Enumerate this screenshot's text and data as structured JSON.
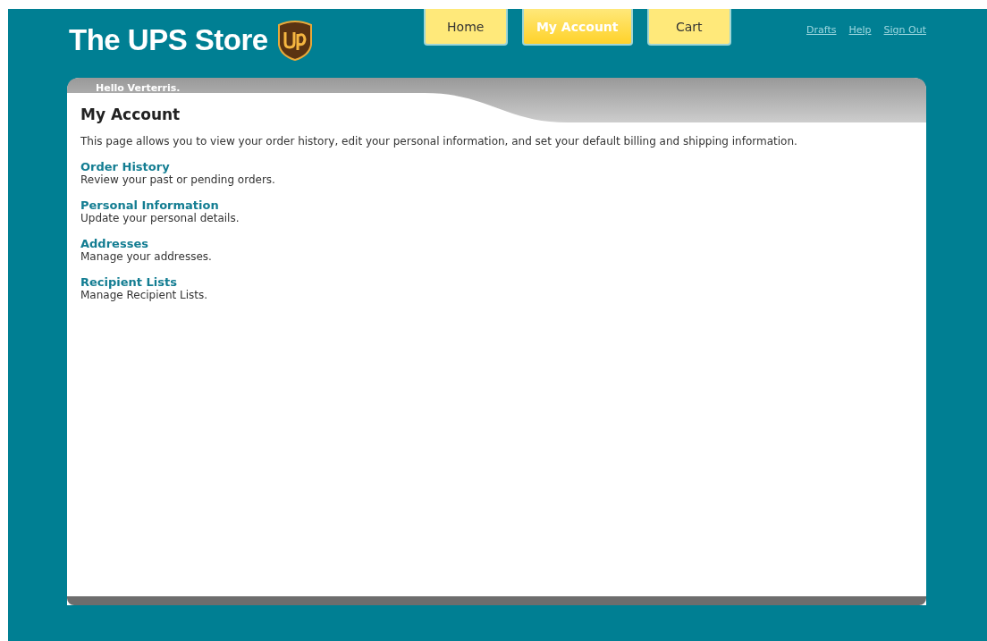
{
  "logo": {
    "text": "The UPS Store"
  },
  "tabs": [
    {
      "label": "Home",
      "selected": false
    },
    {
      "label": "My Account",
      "selected": true
    },
    {
      "label": "Cart",
      "selected": false
    }
  ],
  "top_links": [
    "Drafts",
    "Help",
    "Sign Out"
  ],
  "greeting": "Hello Verterris.",
  "page_title": "My Account",
  "intro": "This page allows you to view your order history, edit your personal information, and set your default billing and shipping information.",
  "sections": [
    {
      "title": "Order History",
      "description": "Review your past or pending orders."
    },
    {
      "title": "Personal Information",
      "description": "Update your personal details."
    },
    {
      "title": "Addresses",
      "description": "Manage your addresses."
    },
    {
      "title": "Recipient Lists",
      "description": "Manage Recipient Lists."
    }
  ]
}
